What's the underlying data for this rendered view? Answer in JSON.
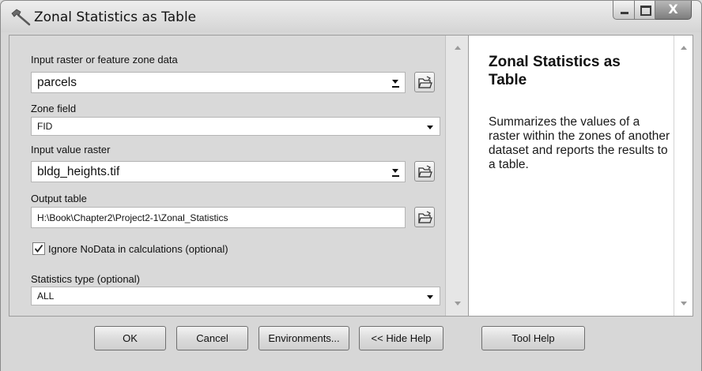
{
  "window": {
    "title": "Zonal Statistics as Table"
  },
  "form": {
    "input_zone": {
      "label": "Input raster or feature zone data",
      "value": "parcels"
    },
    "zone_field": {
      "label": "Zone field",
      "value": "FID"
    },
    "input_value_raster": {
      "label": "Input value raster",
      "value": "bldg_heights.tif"
    },
    "output_table": {
      "label": "Output table",
      "value": "H:\\Book\\Chapter2\\Project2-1\\Zonal_Statistics"
    },
    "ignore_nodata": {
      "label": "Ignore NoData in calculations (optional)",
      "checked": true
    },
    "statistics_type": {
      "label": "Statistics type (optional)",
      "value": "ALL"
    }
  },
  "help": {
    "title": "Zonal Statistics as Table",
    "body": "Summarizes the values of a raster within the zones of another dataset and reports the results to a table."
  },
  "buttons": {
    "ok": "OK",
    "cancel": "Cancel",
    "environments": "Environments...",
    "hide_help": "<< Hide Help",
    "tool_help": "Tool Help"
  },
  "window_controls": {
    "close": "X"
  },
  "icons": {
    "app": "hammer-icon",
    "browse": "open-folder-icon",
    "checkbox": "checkmark-icon"
  }
}
